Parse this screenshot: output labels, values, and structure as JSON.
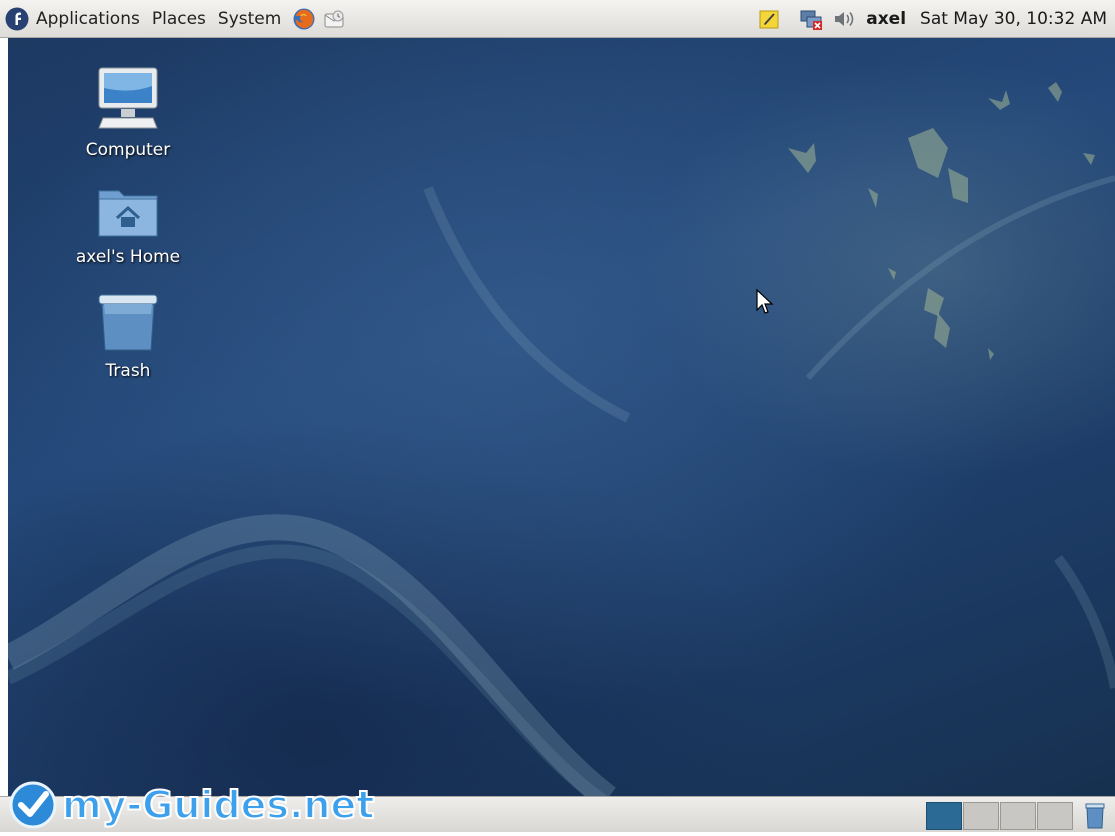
{
  "top_panel": {
    "menus": [
      "Applications",
      "Places",
      "System"
    ],
    "launchers": [
      "firefox-icon",
      "mail-icon"
    ],
    "tray_icons": [
      "notes-icon",
      "network-icon",
      "volume-icon"
    ],
    "user": "axel",
    "clock": "Sat May 30, 10:32 AM"
  },
  "desktop": {
    "icons": [
      {
        "label": "Computer",
        "icon": "computer-icon"
      },
      {
        "label": "axel's Home",
        "icon": "home-folder-icon"
      },
      {
        "label": "Trash",
        "icon": "trash-icon"
      }
    ]
  },
  "bottom_panel": {
    "workspaces": 4,
    "active_workspace": 1
  },
  "watermark": {
    "text": "my-Guides.net"
  },
  "colors": {
    "panel": "#e8e6e3",
    "desktop_bg": "#1f416e",
    "active_workspace": "#2c6a96",
    "fedora_blue": "#294172"
  }
}
